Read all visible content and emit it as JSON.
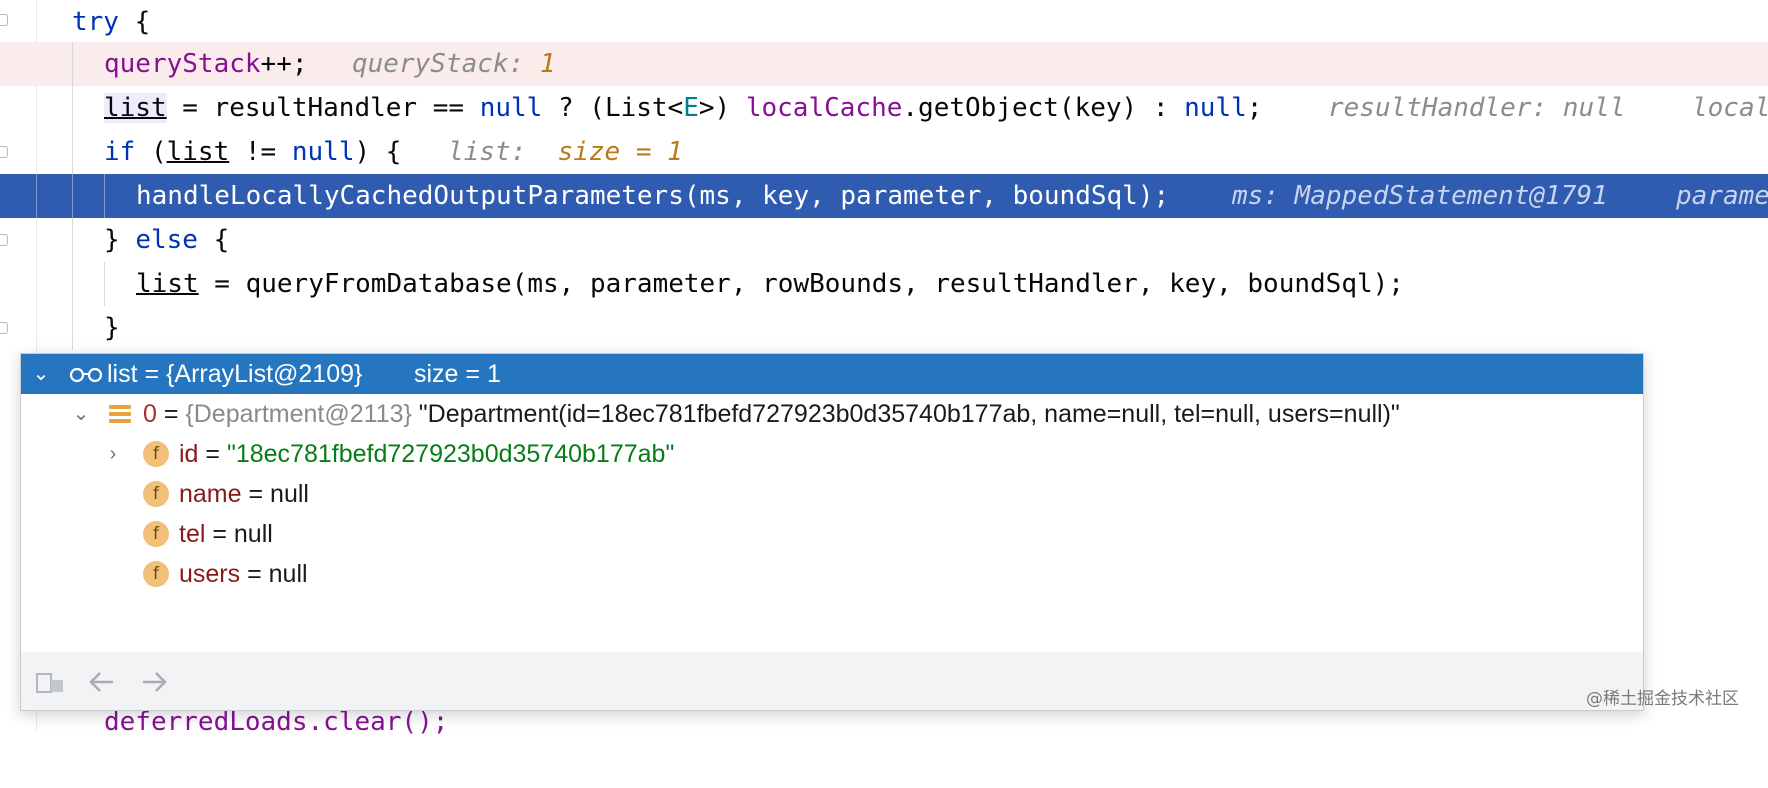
{
  "editor": {
    "lines": {
      "try": {
        "kw": "try",
        "brace": " {"
      },
      "query_stack": {
        "code_field": "queryStack",
        "code_rest": "++;",
        "hint_label": "queryStack: ",
        "hint_value": "1"
      },
      "list_assign": {
        "var": "list",
        "a": " = resultHandler == ",
        "null1": "null",
        "b": " ? (List<",
        "type_param": "E",
        "c": ">) ",
        "cache_field": "localCache",
        "d": ".getObject(key) : ",
        "null2": "null",
        "e": ";",
        "hint1": "resultHandler: null",
        "hint2": "local"
      },
      "if_line": {
        "kw_if": "if",
        "a": " (",
        "var": "list",
        "b": " != ",
        "null": "null",
        "c": ") {",
        "hint_label": "list:  ",
        "hint_value": "size = 1"
      },
      "selected": {
        "code": "handleLocallyCachedOutputParameters(ms, key, parameter, boundSql);",
        "hint1": "ms: MappedStatement@1791",
        "hint2": "parame"
      },
      "else_line": {
        "a": "} ",
        "kw_else": "else",
        "b": " {"
      },
      "query_db": {
        "var": "list",
        "rest": " = queryFromDatabase(ms, parameter, rowBounds, resultHandler, key, boundSql);"
      },
      "close": {
        "text": "}"
      },
      "deferred": {
        "text": "deferredLoads.clear();"
      }
    }
  },
  "popup": {
    "header": {
      "text": "list = {ArrayList@2109}",
      "size": "size = 1"
    },
    "item0": {
      "index": "0",
      "eq": " = ",
      "ref": "{Department@2113}",
      "value": " \"Department(id=18ec781fbefd727923b0d35740b177ab, name=null, tel=null, users=null)\""
    },
    "fields": [
      {
        "icon_letter": "f",
        "name": "id",
        "eq": " = ",
        "value": "\"18ec781fbefd727923b0d35740b177ab\"",
        "is_string": true
      },
      {
        "icon_letter": "f",
        "name": "name",
        "eq": " = ",
        "value": "null",
        "is_string": false
      },
      {
        "icon_letter": "f",
        "name": "tel",
        "eq": " = ",
        "value": "null",
        "is_string": false
      },
      {
        "icon_letter": "f",
        "name": "users",
        "eq": " = ",
        "value": "null",
        "is_string": false
      }
    ],
    "footer_icons": [
      "hierarchy-icon",
      "back-arrow-icon",
      "forward-arrow-icon"
    ]
  },
  "watermark": "@稀土掘金技术社区",
  "colors": {
    "selection": "#2f5bb1",
    "popup_header": "#2675bf",
    "keyword": "#0033b3",
    "field": "#871094",
    "string": "#067d17",
    "hint_value": "#b87b18"
  }
}
